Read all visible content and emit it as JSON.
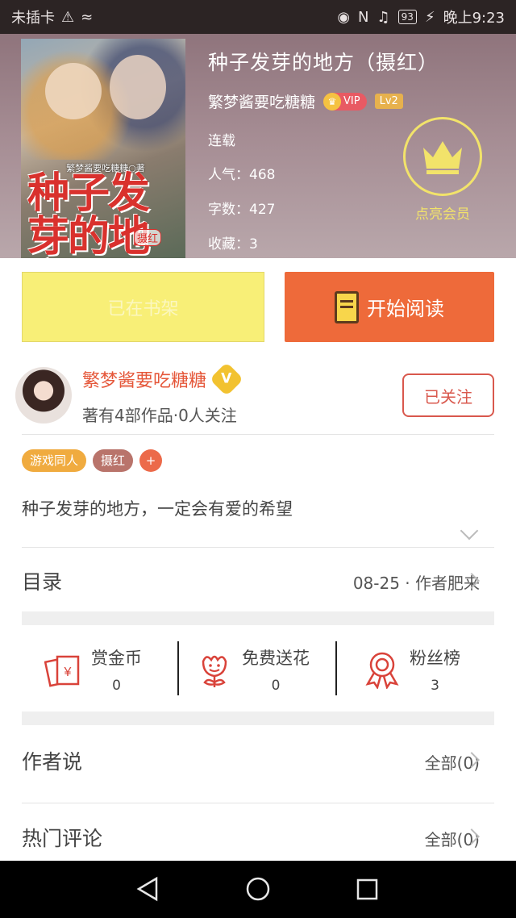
{
  "status_bar": {
    "carrier": "未插卡",
    "battery": "93",
    "time": "晚上9:23"
  },
  "book": {
    "title": "种子发芽的地方（摄红）",
    "author": "繁梦酱要吃糖糖",
    "vip_label": "VIP",
    "level": "Lv2",
    "status": "连载",
    "popularity": "人气：468",
    "word_count": "字数：427",
    "favorites": "收藏：3",
    "member_label": "点亮会员"
  },
  "cover": {
    "author_text": "繁梦酱要吃糖糖○著",
    "title_text": "种子发芽的地方",
    "sub_text": "摄红"
  },
  "actions": {
    "shelf_label": "已在书架",
    "read_label": "开始阅读"
  },
  "author_card": {
    "name": "繁梦酱要吃糖糖",
    "verified": "V",
    "stats": "著有4部作品·0人关注",
    "follow_label": "已关注"
  },
  "tags": [
    "游戏同人",
    "摄红",
    "+"
  ],
  "description": "种子发芽的地方，一定会有爱的希望",
  "catalog": {
    "label": "目录",
    "latest": "08-25 · 作者肥来"
  },
  "stats": [
    {
      "label": "赏金币",
      "value": "0",
      "icon": "red-envelope-icon"
    },
    {
      "label": "免费送花",
      "value": "0",
      "icon": "flower-icon"
    },
    {
      "label": "粉丝榜",
      "value": "3",
      "icon": "medal-icon"
    }
  ],
  "author_says": {
    "label": "作者说",
    "right": "全部(0)"
  },
  "hot_comments": {
    "label": "热门评论",
    "right": "全部(0)"
  },
  "colors": {
    "accent_orange": "#ee6a3a",
    "shelf_yellow": "#f8ef77",
    "author_red": "#e5573a",
    "member_yellow": "#f2e36a"
  }
}
